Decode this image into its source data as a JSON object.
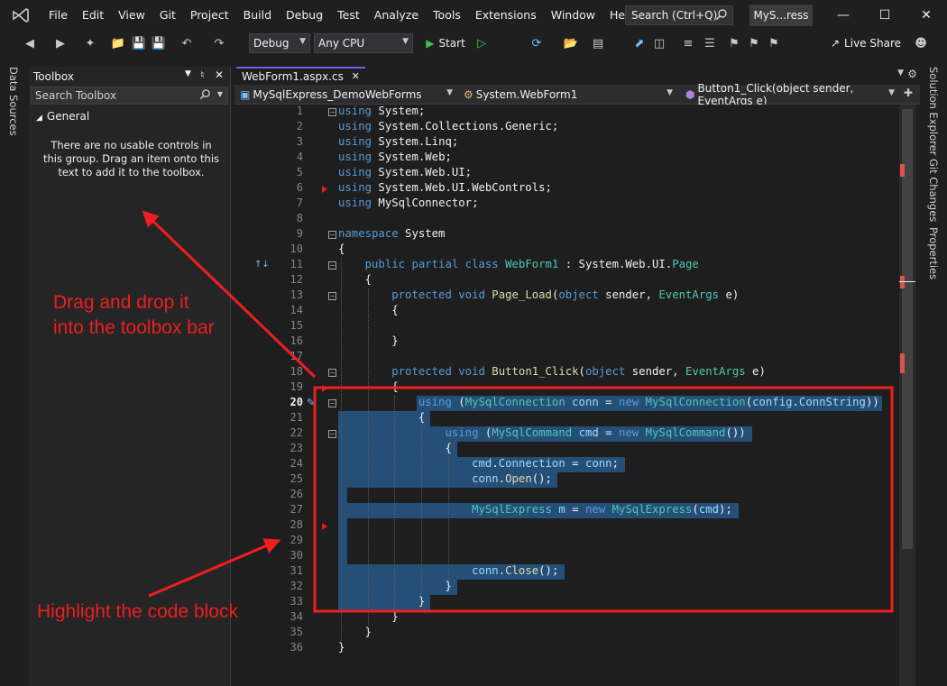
{
  "menubar": {
    "items": [
      "File",
      "Edit",
      "View",
      "Git",
      "Project",
      "Build",
      "Debug",
      "Test",
      "Analyze",
      "Tools",
      "Extensions",
      "Window",
      "Help"
    ],
    "search_placeholder": "Search (Ctrl+Q)",
    "solution_name": "MyS...ress",
    "minimize": "—",
    "maximize": "☐",
    "close": "✕"
  },
  "toolbar": {
    "configuration": "Debug",
    "platform": "Any CPU",
    "start_label": "Start",
    "live_share_label": "Live Share"
  },
  "side_tabs": {
    "left": [
      "Data Sources"
    ],
    "right": [
      "Solution Explorer",
      "Git Changes",
      "Properties"
    ]
  },
  "toolbox": {
    "title": "Toolbox",
    "search_placeholder": "Search Toolbox",
    "group_name": "General",
    "empty_message": "There are no usable controls in this group. Drag an item onto this text to add it to the toolbox."
  },
  "editor": {
    "tab_title": "WebForm1.aspx.cs",
    "nav": {
      "project": "MySqlExpress_DemoWebForms",
      "type": "System.WebForm1",
      "member": "Button1_Click(object sender, EventArgs e)"
    },
    "current_line": 20,
    "lines": [
      [
        [
          "k",
          "using"
        ],
        [
          "w",
          " System;"
        ]
      ],
      [
        [
          "k",
          "using"
        ],
        [
          "w",
          " System.Collections.Generic;"
        ]
      ],
      [
        [
          "k",
          "using"
        ],
        [
          "w",
          " System.Linq;"
        ]
      ],
      [
        [
          "k",
          "using"
        ],
        [
          "w",
          " System.Web;"
        ]
      ],
      [
        [
          "k",
          "using"
        ],
        [
          "w",
          " System.Web.UI;"
        ]
      ],
      [
        [
          "k",
          "using"
        ],
        [
          "w",
          " System.Web.UI.WebControls;"
        ]
      ],
      [
        [
          "k",
          "using"
        ],
        [
          "w",
          " MySqlConnector;"
        ]
      ],
      [],
      [
        [
          "k",
          "namespace"
        ],
        [
          "w",
          " System"
        ]
      ],
      [
        [
          "w",
          "{"
        ]
      ],
      [
        [
          "w",
          "    "
        ],
        [
          "k",
          "public partial class"
        ],
        [
          "w",
          " "
        ],
        [
          "t",
          "WebForm1"
        ],
        [
          "w",
          " : System.Web.UI."
        ],
        [
          "t",
          "Page"
        ]
      ],
      [
        [
          "w",
          "    {"
        ]
      ],
      [
        [
          "w",
          "        "
        ],
        [
          "k",
          "protected void"
        ],
        [
          "w",
          " "
        ],
        [
          "m",
          "Page_Load"
        ],
        [
          "w",
          "("
        ],
        [
          "k",
          "object"
        ],
        [
          "w",
          " sender, "
        ],
        [
          "t",
          "EventArgs"
        ],
        [
          "w",
          " e)"
        ]
      ],
      [
        [
          "w",
          "        {"
        ]
      ],
      [],
      [
        [
          "w",
          "        }"
        ]
      ],
      [],
      [
        [
          "w",
          "        "
        ],
        [
          "k",
          "protected void"
        ],
        [
          "w",
          " "
        ],
        [
          "m",
          "Button1_Click"
        ],
        [
          "w",
          "("
        ],
        [
          "k",
          "object"
        ],
        [
          "w",
          " sender, "
        ],
        [
          "t",
          "EventArgs"
        ],
        [
          "w",
          " e)"
        ]
      ],
      [
        [
          "w",
          "        {"
        ]
      ],
      [
        [
          "w",
          "            "
        ],
        [
          "k",
          "using"
        ],
        [
          "w",
          " ("
        ],
        [
          "t",
          "MySqlConnection"
        ],
        [
          "w",
          " "
        ],
        [
          "p",
          "conn"
        ],
        [
          "w",
          " = "
        ],
        [
          "k",
          "new"
        ],
        [
          "w",
          " "
        ],
        [
          "t",
          "MySqlConnection"
        ],
        [
          "w",
          "("
        ],
        [
          "p",
          "config"
        ],
        [
          "w",
          "."
        ],
        [
          "p",
          "ConnString"
        ],
        [
          "w",
          "))"
        ]
      ],
      [
        [
          "w",
          "            {"
        ]
      ],
      [
        [
          "w",
          "                "
        ],
        [
          "k",
          "using"
        ],
        [
          "w",
          " ("
        ],
        [
          "t",
          "MySqlCommand"
        ],
        [
          "w",
          " "
        ],
        [
          "p",
          "cmd"
        ],
        [
          "w",
          " = "
        ],
        [
          "k",
          "new"
        ],
        [
          "w",
          " "
        ],
        [
          "t",
          "MySqlCommand"
        ],
        [
          "w",
          "())"
        ]
      ],
      [
        [
          "w",
          "                {"
        ]
      ],
      [
        [
          "w",
          "                    "
        ],
        [
          "p",
          "cmd"
        ],
        [
          "w",
          "."
        ],
        [
          "p",
          "Connection"
        ],
        [
          "w",
          " = "
        ],
        [
          "p",
          "conn"
        ],
        [
          "w",
          ";"
        ]
      ],
      [
        [
          "w",
          "                    "
        ],
        [
          "p",
          "conn"
        ],
        [
          "w",
          "."
        ],
        [
          "m",
          "Open"
        ],
        [
          "w",
          "();"
        ]
      ],
      [],
      [
        [
          "w",
          "                    "
        ],
        [
          "t",
          "MySqlExpress"
        ],
        [
          "w",
          " "
        ],
        [
          "p",
          "m"
        ],
        [
          "w",
          " = "
        ],
        [
          "k",
          "new"
        ],
        [
          "w",
          " "
        ],
        [
          "t",
          "MySqlExpress"
        ],
        [
          "w",
          "("
        ],
        [
          "p",
          "cmd"
        ],
        [
          "w",
          ");"
        ]
      ],
      [],
      [],
      [],
      [
        [
          "w",
          "                    "
        ],
        [
          "p",
          "conn"
        ],
        [
          "w",
          "."
        ],
        [
          "m",
          "Close"
        ],
        [
          "w",
          "();"
        ]
      ],
      [
        [
          "w",
          "                }"
        ]
      ],
      [
        [
          "w",
          "            }"
        ]
      ],
      [
        [
          "w",
          "        }"
        ]
      ],
      [
        [
          "w",
          "    }"
        ]
      ],
      [
        [
          "w",
          "}"
        ]
      ]
    ]
  },
  "annotations": {
    "drag_hint": "Drag and drop it\ninto the toolbox bar",
    "highlight_hint": "Highlight the code block"
  },
  "colors": {
    "keyword": "#569cd6",
    "type": "#4ec9b0",
    "method": "#dcdcaa",
    "identifier": "#9cdcfe",
    "selection": "#264f78",
    "annotation": "#f01e1e",
    "accent": "#7160e8"
  }
}
